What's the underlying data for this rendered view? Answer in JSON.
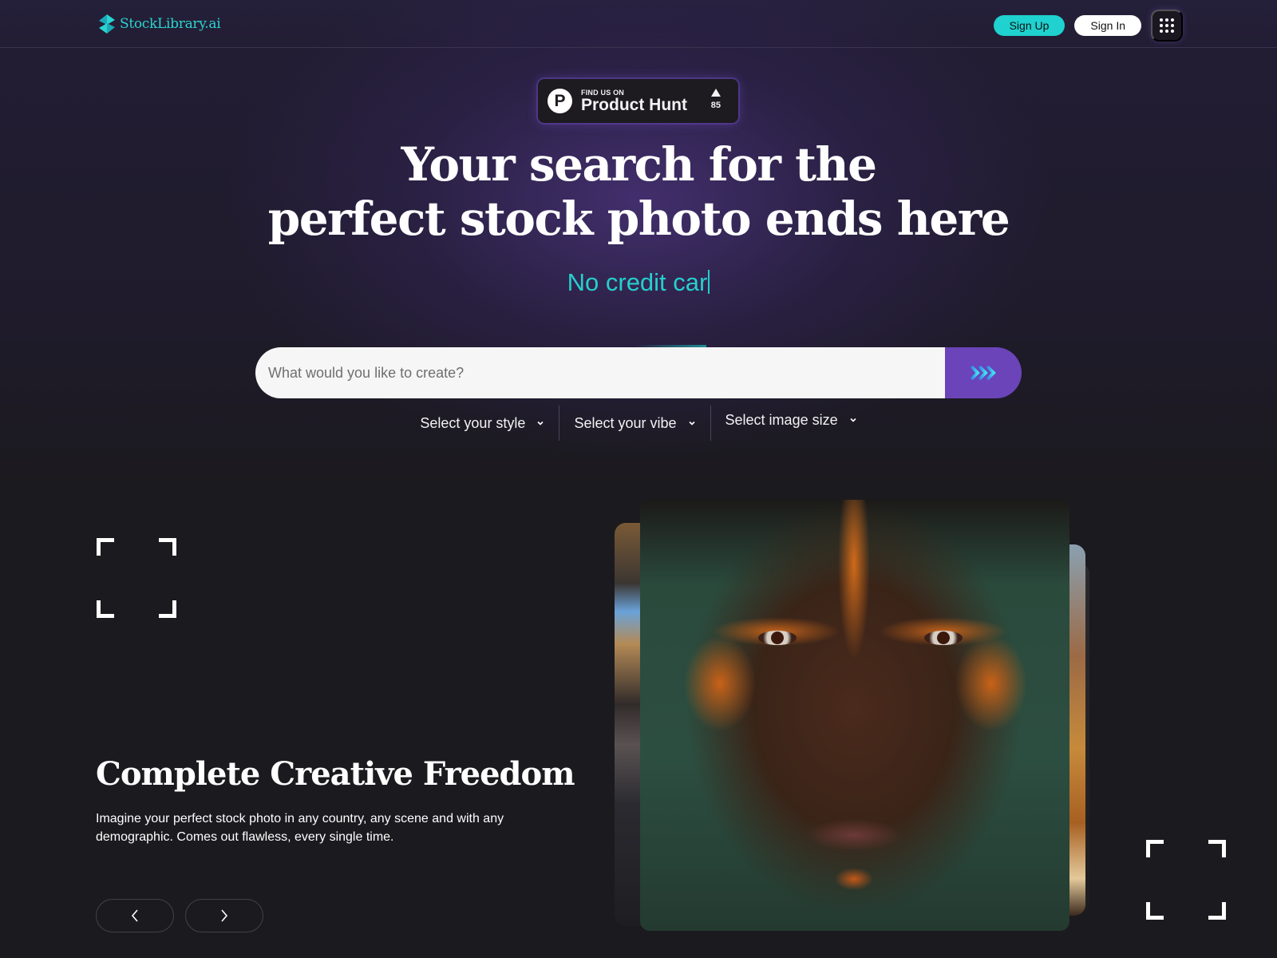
{
  "brand": {
    "name": "StockLibrary.ai",
    "accent_color": "#1fd1cf",
    "primary_color": "#6a44b8"
  },
  "nav": {
    "sign_up_label": "Sign Up",
    "sign_in_label": "Sign In",
    "apps_icon": "grid-dots-icon"
  },
  "product_hunt": {
    "small_label": "FIND US ON",
    "big_label": "Product Hunt",
    "logo_letter": "P",
    "upvote_count": "85"
  },
  "hero": {
    "title_line1": "Your search for the",
    "title_line2": "perfect stock photo ends here",
    "typing_text": "No credit car"
  },
  "search": {
    "placeholder": "What would you like to create?",
    "value": "",
    "submit_icon": "triple-chevron-right-icon"
  },
  "selectors": [
    {
      "label": "Select your style"
    },
    {
      "label": "Select your vibe"
    },
    {
      "label": "Select image size"
    }
  ],
  "feature": {
    "title": "Complete Creative Freedom",
    "description": "Imagine your perfect stock photo in any country, any scene and with any demographic. Comes out flawless, every single time."
  },
  "carousel": {
    "prev_icon": "chevron-left-icon",
    "next_icon": "chevron-right-icon",
    "main_image_alt": "Portrait with orange and green face paint",
    "side_images": [
      "interior-shop-scene",
      "ocean-coral-reef",
      "food-dish",
      "dark-card"
    ]
  }
}
